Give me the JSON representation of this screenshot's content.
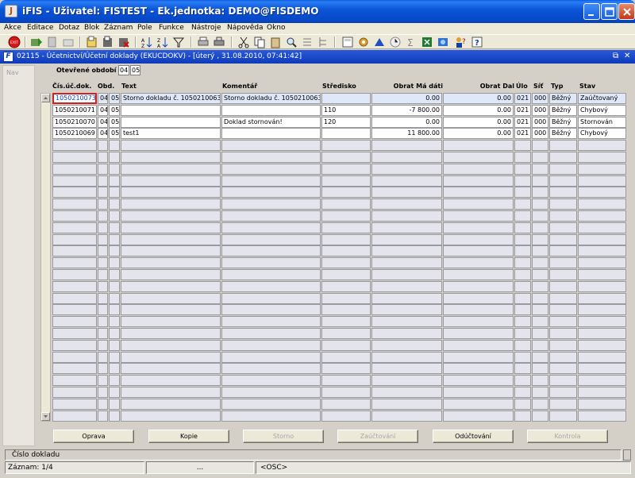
{
  "window": {
    "title": "iFIS - Uživatel: FISTEST - Ek.jednotka: DEMO@FISDEMO",
    "app_icon_glyph": "J"
  },
  "menu": [
    {
      "label": "Akce"
    },
    {
      "label": "Editace"
    },
    {
      "label": "Dotaz"
    },
    {
      "label": "Blok"
    },
    {
      "label": "Záznam"
    },
    {
      "label": "Pole"
    },
    {
      "label": "Funkce"
    },
    {
      "label": "Nástroje"
    },
    {
      "label": "Nápověda"
    },
    {
      "label": "Okno"
    }
  ],
  "toolbar_exit_label": "EXIT",
  "form": {
    "title": "02115 - Účetnictví/Účetní doklady (EKUCDOKV) - [úterý  , 31.08.2010, 07:41:42]",
    "nav_label": "Nav",
    "period_label": "Otevřené období",
    "period_year": "04",
    "period_month": "05"
  },
  "table": {
    "columns": [
      "Čís.úč.dok.",
      "Obd.",
      "Text",
      "Komentář",
      "Středisko",
      "Obrat Má dáti",
      "Obrat Dal",
      "Úlo",
      "Síť",
      "Typ",
      "Stav"
    ],
    "rows": [
      [
        "1050210073",
        "04",
        "05",
        "Storno dokladu č. 1050210063",
        "Storno dokladu č. 1050210063",
        "",
        "0.00",
        "0.00",
        "021",
        "000",
        "Běžný",
        "Zaúčtovaný"
      ],
      [
        "1050210071",
        "04",
        "05",
        "",
        "",
        "110",
        "-7 800.00",
        "0.00",
        "021",
        "000",
        "Běžný",
        "Chybový"
      ],
      [
        "1050210070",
        "04",
        "05",
        "",
        "Doklad stornován!",
        "120",
        "0.00",
        "0.00",
        "021",
        "000",
        "Běžný",
        "Stornován"
      ],
      [
        "1050210069",
        "04",
        "05",
        "test1",
        "",
        "",
        "11 800.00",
        "0.00",
        "021",
        "000",
        "Běžný",
        "Chybový"
      ]
    ]
  },
  "buttons": {
    "oprava": "Oprava",
    "kopie": "Kopie",
    "storno": "Storno",
    "zauctovani": "Zaúčtování",
    "oductovani": "Odúčtování",
    "kontrola": "Kontrola"
  },
  "status": {
    "field_hint": "Číslo dokladu",
    "record": "Záznam: 1/4",
    "seg2": "...",
    "seg3": "<OSC>"
  }
}
